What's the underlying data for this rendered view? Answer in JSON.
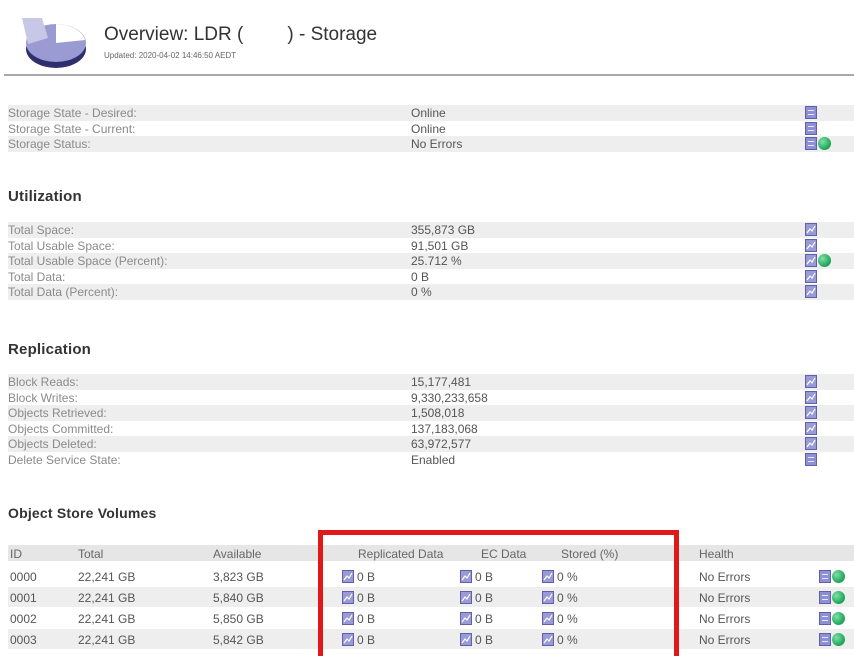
{
  "header": {
    "title_prefix": "Overview: LDR (",
    "title_suffix": ") - Storage",
    "updated": "Updated: 2020-04-02 14:46:50 AEDT"
  },
  "storage": [
    {
      "label": "Storage State - Desired:",
      "value": "Online",
      "icon": "doc-icon",
      "status": false
    },
    {
      "label": "Storage State - Current:",
      "value": "Online",
      "icon": "doc-icon",
      "status": false
    },
    {
      "label": "Storage Status:",
      "value": "No Errors",
      "icon": "doc-icon",
      "status": true
    }
  ],
  "utilization": {
    "heading": "Utilization",
    "rows": [
      {
        "label": "Total Space:",
        "value": "355,873 GB",
        "icon": "chart-icon",
        "status": false
      },
      {
        "label": "Total Usable Space:",
        "value": "91,501 GB",
        "icon": "chart-icon",
        "status": false
      },
      {
        "label": "Total Usable Space (Percent):",
        "value": "25.712 %",
        "icon": "chart-icon",
        "status": true
      },
      {
        "label": "Total Data:",
        "value": "0 B",
        "icon": "chart-icon",
        "status": false
      },
      {
        "label": "Total Data (Percent):",
        "value": "0 %",
        "icon": "chart-icon",
        "status": false
      }
    ]
  },
  "replication": {
    "heading": "Replication",
    "rows": [
      {
        "label": "Block Reads:",
        "value": "15,177,481",
        "icon": "chart-icon",
        "status": false
      },
      {
        "label": "Block Writes:",
        "value": "9,330,233,658",
        "icon": "chart-icon",
        "status": false
      },
      {
        "label": "Objects Retrieved:",
        "value": "1,508,018",
        "icon": "chart-icon",
        "status": false
      },
      {
        "label": "Objects Committed:",
        "value": "137,183,068",
        "icon": "chart-icon",
        "status": false
      },
      {
        "label": "Objects Deleted:",
        "value": "63,972,577",
        "icon": "chart-icon",
        "status": false
      },
      {
        "label": "Delete Service State:",
        "value": "Enabled",
        "icon": "doc-icon",
        "status": false
      }
    ]
  },
  "volumes": {
    "heading": "Object Store Volumes",
    "columns": {
      "id": "ID",
      "total": "Total",
      "available": "Available",
      "replicated": "Replicated Data",
      "ec": "EC Data",
      "stored": "Stored (%)",
      "health": "Health"
    },
    "rows": [
      {
        "id": "0000",
        "total": "22,241 GB",
        "available": "3,823 GB",
        "replicated": "0 B",
        "ec": "0 B",
        "stored": "0 %",
        "health": "No Errors"
      },
      {
        "id": "0001",
        "total": "22,241 GB",
        "available": "5,840 GB",
        "replicated": "0 B",
        "ec": "0 B",
        "stored": "0 %",
        "health": "No Errors"
      },
      {
        "id": "0002",
        "total": "22,241 GB",
        "available": "5,850 GB",
        "replicated": "0 B",
        "ec": "0 B",
        "stored": "0 %",
        "health": "No Errors"
      },
      {
        "id": "0003",
        "total": "22,241 GB",
        "available": "5,842 GB",
        "replicated": "0 B",
        "ec": "0 B",
        "stored": "0 %",
        "health": "No Errors"
      }
    ]
  },
  "colors": {
    "highlight": "#e01818",
    "row_stripe": "#eeeeee",
    "icon_blue": "#8e8fd4",
    "status_green": "#21a85a"
  }
}
